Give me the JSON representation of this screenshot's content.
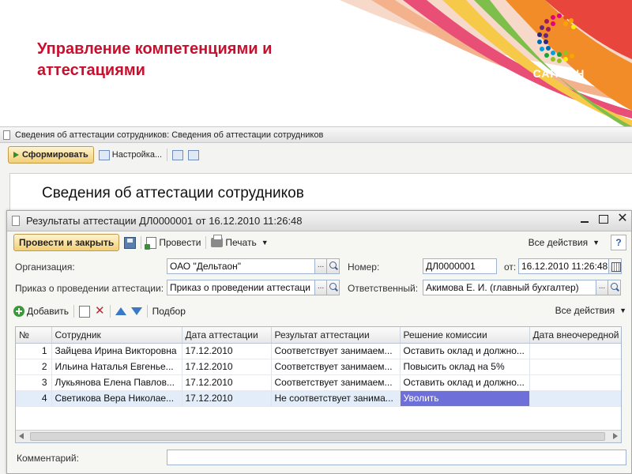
{
  "slide": {
    "title_line1": "Управление компетенциями и",
    "title_line2": "аттестациями",
    "logo_text": "САПСАН",
    "title_color": "#c8102e"
  },
  "report_window": {
    "title": "Сведения об аттестации сотрудников: Сведения об аттестации сотрудников",
    "toolbar": {
      "generate_label": "Сформировать",
      "settings_label": "Настройка..."
    },
    "report_heading": "Сведения об аттестации сотрудников"
  },
  "doc_window": {
    "title": "Результаты аттестации ДЛ0000001 от 16.12.2010 11:26:48",
    "toolbar": {
      "post_and_close_label": "Провести и закрыть",
      "post_label": "Провести",
      "print_label": "Печать",
      "all_actions_label": "Все действия",
      "help_label": "?"
    },
    "form": {
      "organization_label": "Организация:",
      "organization_value": "ОАО \"Дельтаон\"",
      "number_label": "Номер:",
      "number_value": "ДЛ0000001",
      "date_label": "от:",
      "date_value": "16.12.2010 11:26:48",
      "order_label": "Приказ о проведении аттестации:",
      "order_value": "Приказ о проведении аттестаци",
      "responsible_label": "Ответственный:",
      "responsible_value": "Акимова Е. И. (главный бухгалтер)",
      "select_button": "..."
    },
    "grid_toolbar": {
      "add_label": "Добавить",
      "selection_label": "Подбор",
      "all_actions_label": "Все действия"
    },
    "table": {
      "columns": [
        "№",
        "Сотрудник",
        "Дата аттестации",
        "Результат аттестации",
        "Решение комиссии",
        "Дата внеочередной"
      ],
      "rows": [
        {
          "n": "1",
          "employee": "Зайцева Ирина Викторовна",
          "date": "17.12.2010",
          "result": "Соответствует занимаем...",
          "decision": "Оставить оклад и должно...",
          "extra": ""
        },
        {
          "n": "2",
          "employee": "Ильина Наталья Евгенье...",
          "date": "17.12.2010",
          "result": "Соответствует занимаем...",
          "decision": "Повысить оклад на 5%",
          "extra": ""
        },
        {
          "n": "3",
          "employee": "Лукьянова Елена Павлов...",
          "date": "17.12.2010",
          "result": "Соответствует занимаем...",
          "decision": "Оставить оклад и должно...",
          "extra": ""
        },
        {
          "n": "4",
          "employee": "Светикова Вера Николае...",
          "date": "17.12.2010",
          "result": "Не соответствует занима...",
          "decision": "Уволить",
          "extra": ""
        }
      ],
      "selected_row": 4
    },
    "comment_label": "Комментарий:",
    "comment_value": ""
  }
}
